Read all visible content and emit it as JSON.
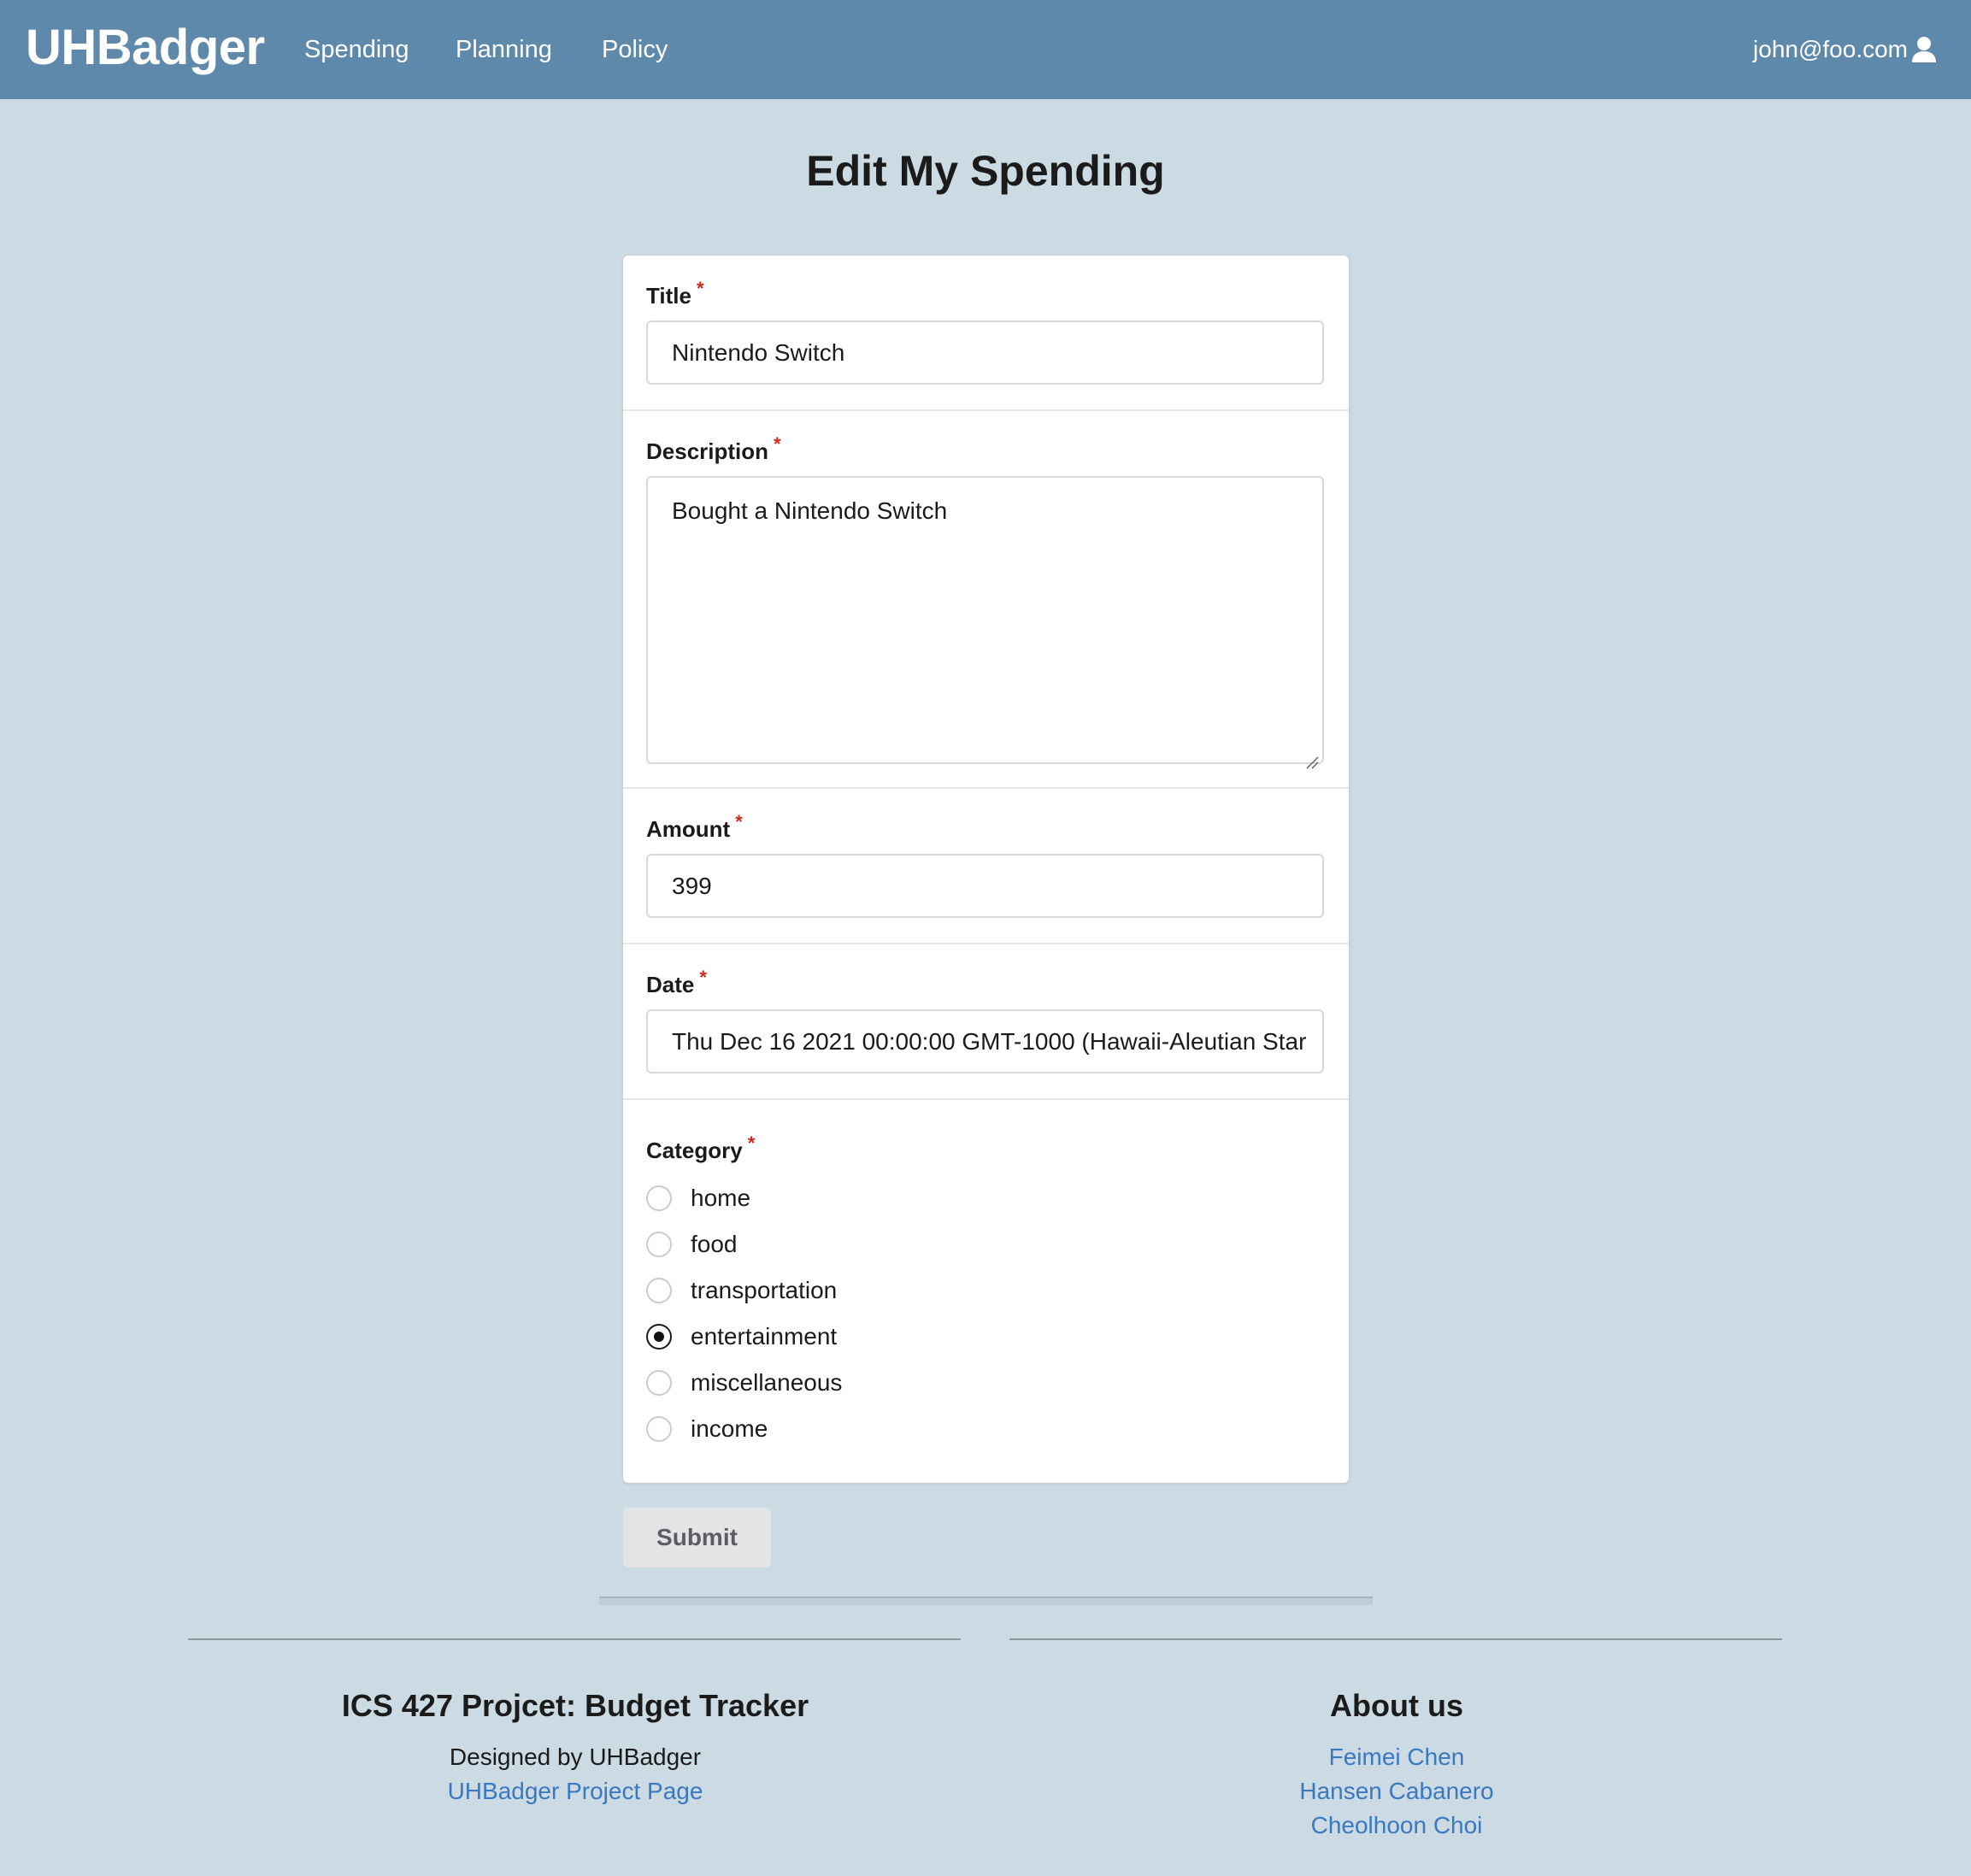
{
  "navbar": {
    "brand": "UHBadger",
    "links": [
      "Spending",
      "Planning",
      "Policy"
    ],
    "user": "john@foo.com"
  },
  "page_title": "Edit My Spending",
  "form": {
    "title_label": "Title",
    "title_value": "Nintendo Switch",
    "description_label": "Description",
    "description_value": "Bought a Nintendo Switch",
    "amount_label": "Amount",
    "amount_value": "399",
    "date_label": "Date",
    "date_value": "Thu Dec 16 2021 00:00:00 GMT-1000 (Hawaii-Aleutian Star",
    "category_label": "Category",
    "categories": [
      "home",
      "food",
      "transportation",
      "entertainment",
      "miscellaneous",
      "income"
    ],
    "selected_category": "entertainment",
    "required_mark": "*",
    "submit_label": "Submit"
  },
  "footer": {
    "left_heading": "ICS 427 Projcet: Budget Tracker",
    "left_text": "Designed by UHBadger",
    "left_link": "UHBadger Project Page",
    "right_heading": "About us",
    "team": [
      "Feimei Chen",
      "Hansen Cabanero",
      "Cheolhoon Choi"
    ]
  },
  "colors": {
    "navbar": "#5f89aa",
    "background": "#cbdae3",
    "link": "#3a78c0",
    "required": "#d0281f"
  }
}
